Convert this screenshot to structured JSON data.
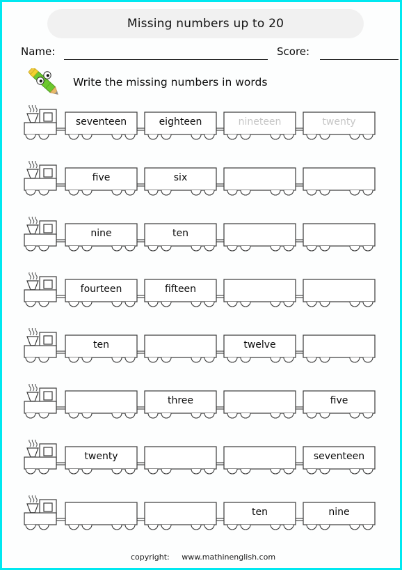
{
  "page": {
    "border_color": "#00e8f0",
    "background": "#fdfefe"
  },
  "header": {
    "title": "Missing numbers up to 20",
    "title_pill_color": "#f1f1f1"
  },
  "fields": {
    "name_label": "Name:",
    "score_label": "Score:",
    "name_value": "",
    "score_value": ""
  },
  "instruction": {
    "text": "Write the missing numbers in words",
    "icon": "pencil-icon",
    "pencil_body_color": "#63c132",
    "pencil_eraser_color": "#f2d22e",
    "pencil_tip_color": "#9a9a9a"
  },
  "trains": [
    {
      "id": "train-1",
      "wagons": [
        {
          "text": "seventeen",
          "faded": false,
          "filled": true
        },
        {
          "text": "eighteen",
          "faded": false,
          "filled": true
        },
        {
          "text": "nineteen",
          "faded": true,
          "filled": true
        },
        {
          "text": "twenty",
          "faded": true,
          "filled": true
        }
      ]
    },
    {
      "id": "train-2",
      "wagons": [
        {
          "text": "five",
          "faded": false,
          "filled": true
        },
        {
          "text": "six",
          "faded": false,
          "filled": true
        },
        {
          "text": "",
          "faded": false,
          "filled": false
        },
        {
          "text": "",
          "faded": false,
          "filled": false
        }
      ]
    },
    {
      "id": "train-3",
      "wagons": [
        {
          "text": "nine",
          "faded": false,
          "filled": true
        },
        {
          "text": "ten",
          "faded": false,
          "filled": true
        },
        {
          "text": "",
          "faded": false,
          "filled": false
        },
        {
          "text": "",
          "faded": false,
          "filled": false
        }
      ]
    },
    {
      "id": "train-4",
      "wagons": [
        {
          "text": "fourteen",
          "faded": false,
          "filled": true
        },
        {
          "text": "fifteen",
          "faded": false,
          "filled": true
        },
        {
          "text": "",
          "faded": false,
          "filled": false
        },
        {
          "text": "",
          "faded": false,
          "filled": false
        }
      ]
    },
    {
      "id": "train-5",
      "wagons": [
        {
          "text": "ten",
          "faded": false,
          "filled": true
        },
        {
          "text": "",
          "faded": false,
          "filled": false
        },
        {
          "text": "twelve",
          "faded": false,
          "filled": true
        },
        {
          "text": "",
          "faded": false,
          "filled": false
        }
      ]
    },
    {
      "id": "train-6",
      "wagons": [
        {
          "text": "",
          "faded": false,
          "filled": false
        },
        {
          "text": "three",
          "faded": false,
          "filled": true
        },
        {
          "text": "",
          "faded": false,
          "filled": false
        },
        {
          "text": "five",
          "faded": false,
          "filled": true
        }
      ]
    },
    {
      "id": "train-7",
      "wagons": [
        {
          "text": "twenty",
          "faded": false,
          "filled": true
        },
        {
          "text": "",
          "faded": false,
          "filled": false
        },
        {
          "text": "",
          "faded": false,
          "filled": false
        },
        {
          "text": "seventeen",
          "faded": false,
          "filled": true
        }
      ]
    },
    {
      "id": "train-8",
      "wagons": [
        {
          "text": "",
          "faded": false,
          "filled": false
        },
        {
          "text": "",
          "faded": false,
          "filled": false
        },
        {
          "text": "ten",
          "faded": false,
          "filled": true
        },
        {
          "text": "nine",
          "faded": false,
          "filled": true
        }
      ]
    }
  ],
  "footer": {
    "copyright_label": "copyright:",
    "website": "www.mathinenglish.com"
  }
}
